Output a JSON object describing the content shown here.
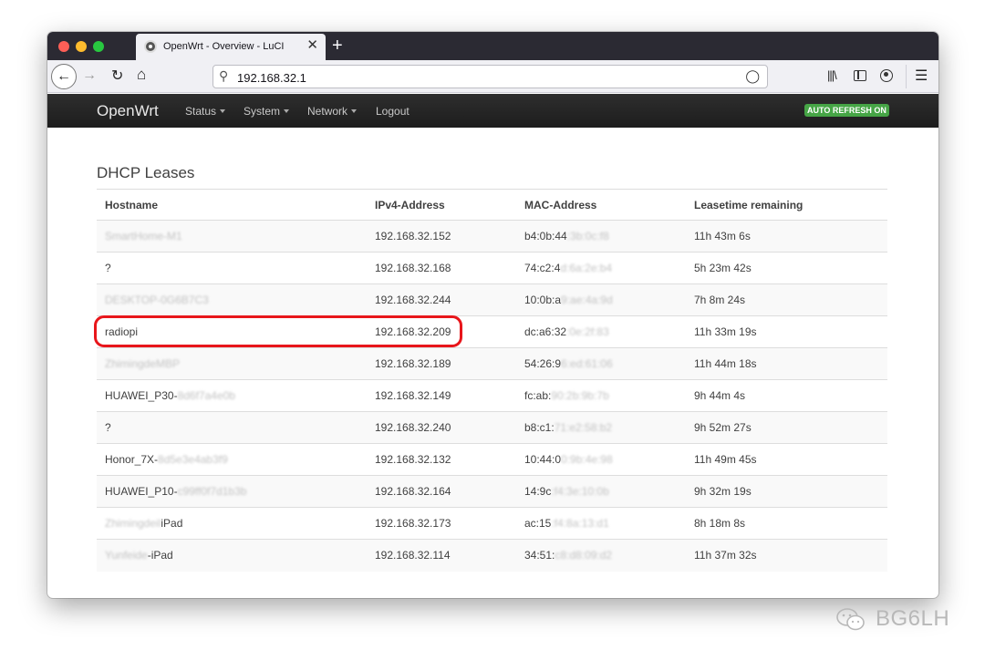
{
  "browser": {
    "tab_title": "OpenWrt - Overview - LuCI",
    "tab_close": "✕",
    "new_tab": "+",
    "url": "192.168.32.1"
  },
  "navbar": {
    "brand": "OpenWrt",
    "menus": [
      "Status",
      "System",
      "Network",
      "Logout"
    ],
    "auto_refresh": "AUTO REFRESH ON",
    "auto_refresh_color": "#46a546"
  },
  "page": {
    "title": "DHCP Leases",
    "columns": [
      "Hostname",
      "IPv4-Address",
      "MAC-Address",
      "Leasetime remaining"
    ],
    "rows": [
      {
        "host": "",
        "host_blur": "SmartHome-M1",
        "ip": "192.168.32.152",
        "mac": "b4:0b:44",
        "mac_blur": ":3b:0c:f8",
        "lease": "11h 43m 6s"
      },
      {
        "host": "?",
        "host_blur": "",
        "ip": "192.168.32.168",
        "mac": "74:c2:4",
        "mac_blur": "d:6a:2e:b4",
        "lease": "5h 23m 42s"
      },
      {
        "host": "",
        "host_blur": "DESKTOP-0G6B7C3",
        "ip": "192.168.32.244",
        "mac": "10:0b:a",
        "mac_blur": "9:ae:4a:9d",
        "lease": "7h 8m 24s"
      },
      {
        "host": "radiopi",
        "host_blur": "",
        "ip": "192.168.32.209",
        "mac": "dc:a6:32",
        "mac_blur": ":0e:2f:83",
        "lease": "11h 33m 19s"
      },
      {
        "host": "",
        "host_blur": "ZhimingdeMBP",
        "ip": "192.168.32.189",
        "mac": "54:26:9",
        "mac_blur": "6:ed:61:06",
        "lease": "11h 44m 18s"
      },
      {
        "host": "HUAWEI_P30-",
        "host_blur": "8d6f7a4e0b",
        "ip": "192.168.32.149",
        "mac": "fc:ab:",
        "mac_blur": "90:2b:9b:7b",
        "lease": "9h 44m 4s"
      },
      {
        "host": "?",
        "host_blur": "",
        "ip": "192.168.32.240",
        "mac": "b8:c1:",
        "mac_blur": "71:e2:58:b2",
        "lease": "9h 52m 27s"
      },
      {
        "host": "Honor_7X-",
        "host_blur": "8d5e3e4ab3f9",
        "ip": "192.168.32.132",
        "mac": "10:44:0",
        "mac_blur": "0:9b:4e:98",
        "lease": "11h 49m 45s"
      },
      {
        "host": "HUAWEI_P10-",
        "host_blur": "c99ff0f7d1b3b",
        "ip": "192.168.32.164",
        "mac": "14:9c",
        "mac_blur": ":f4:3e:10:0b",
        "lease": "9h 32m 19s"
      },
      {
        "host": "iPad",
        "host_blur": "Zhimingdeil",
        "ip": "192.168.32.173",
        "mac": "ac:15",
        "mac_blur": ":f4:8a:13:d1",
        "lease": "8h 18m 8s"
      },
      {
        "host": "-iPad",
        "host_blur": "Yunfeide",
        "ip": "192.168.32.114",
        "mac": "34:51:",
        "mac_blur": "c8:d8:09:d2",
        "lease": "11h 37m 32s"
      }
    ]
  },
  "watermark": {
    "text": "BG6LH"
  }
}
